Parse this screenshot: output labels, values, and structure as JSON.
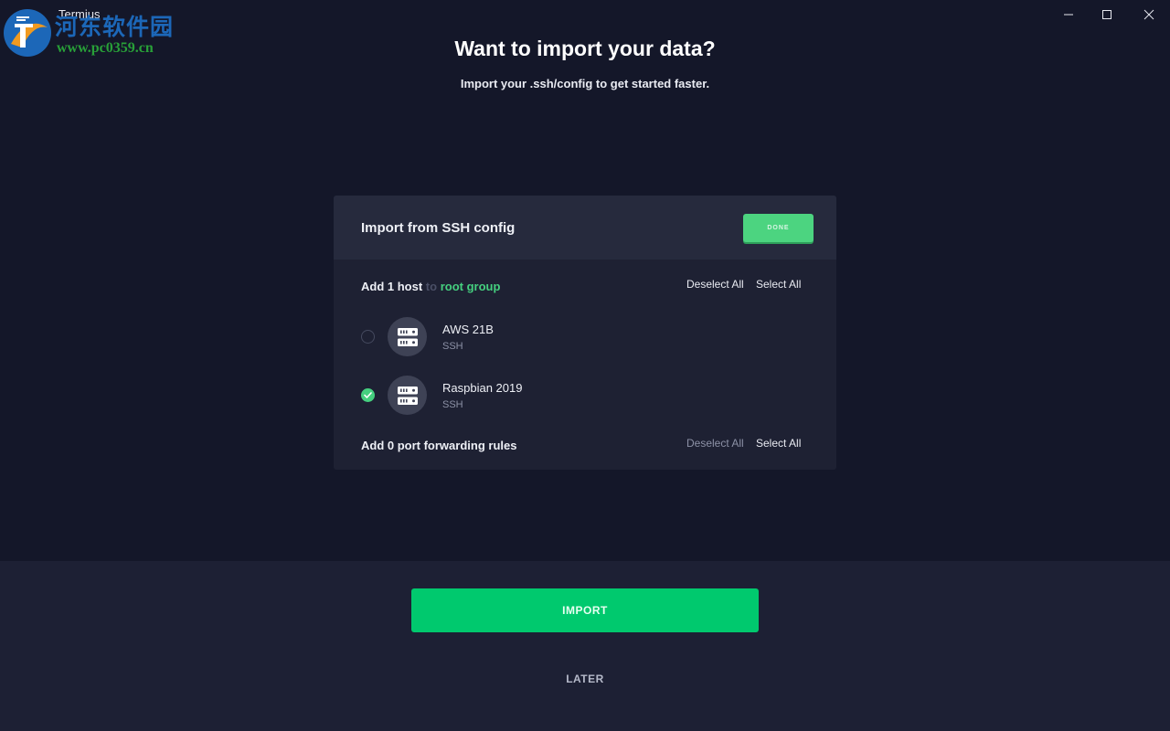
{
  "window": {
    "title": "Termius"
  },
  "watermark": {
    "site_name": "河东软件园",
    "url": "www.pc0359.cn"
  },
  "heading": {
    "title": "Want to import your data?",
    "subtitle": "Import your .ssh/config to get started faster."
  },
  "card": {
    "title": "Import from SSH config",
    "done_label": "DONE",
    "hosts_section": {
      "prefix": "Add 1 host",
      "connector": "to",
      "group": "root group",
      "deselect_all": "Deselect All",
      "select_all": "Select All"
    },
    "hosts": [
      {
        "name": "AWS 21B",
        "type": "SSH",
        "selected": false
      },
      {
        "name": "Raspbian 2019",
        "type": "SSH",
        "selected": true
      }
    ],
    "port_forwarding": {
      "label": "Add 0 port forwarding rules",
      "deselect_all": "Deselect All",
      "select_all": "Select All"
    }
  },
  "actions": {
    "import_label": "IMPORT",
    "later_label": "LATER"
  },
  "colors": {
    "background": "#141729",
    "card": "#1e2133",
    "card_header": "#262a3d",
    "accent_green": "#00c96e",
    "done_green": "#4cd480"
  }
}
